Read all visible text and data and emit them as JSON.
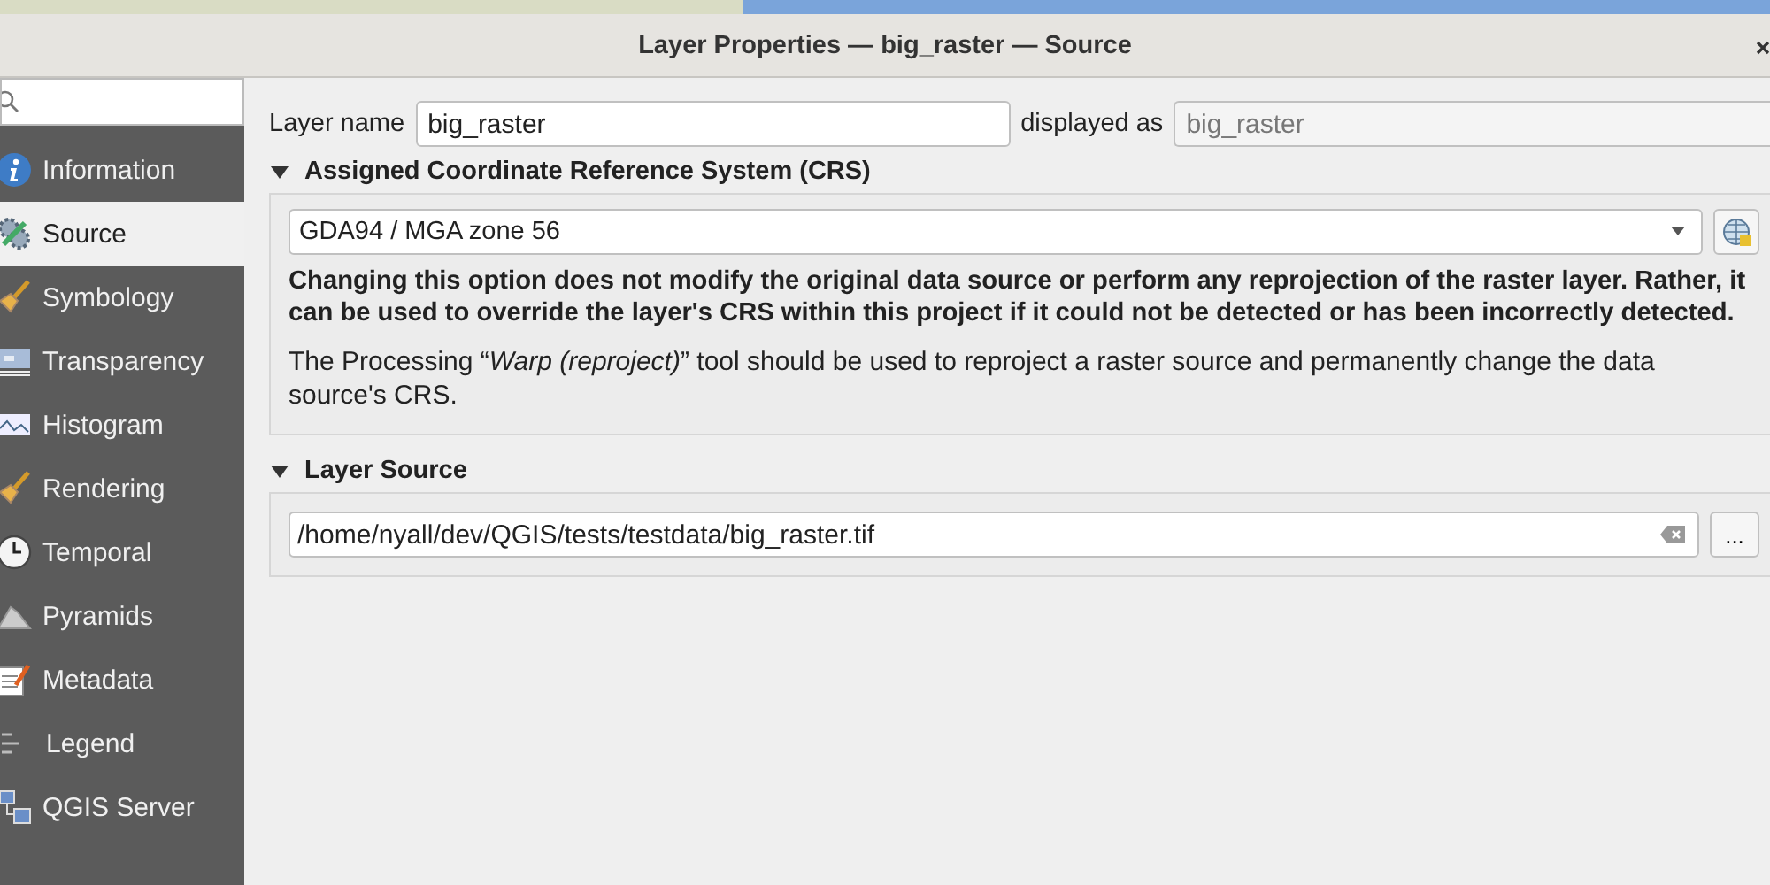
{
  "window": {
    "title": "Layer Properties — big_raster — Source"
  },
  "sidebar": {
    "items": [
      {
        "label": "Information",
        "selected": false
      },
      {
        "label": "Source",
        "selected": true
      },
      {
        "label": "Symbology",
        "selected": false
      },
      {
        "label": "Transparency",
        "selected": false
      },
      {
        "label": "Histogram",
        "selected": false
      },
      {
        "label": "Rendering",
        "selected": false
      },
      {
        "label": "Temporal",
        "selected": false
      },
      {
        "label": "Pyramids",
        "selected": false
      },
      {
        "label": "Metadata",
        "selected": false
      },
      {
        "label": "Legend",
        "selected": false
      },
      {
        "label": "QGIS Server",
        "selected": false
      }
    ]
  },
  "layer_name": {
    "label": "Layer name",
    "value": "big_raster",
    "displayed_as_label": "displayed as",
    "displayed_as_value": "big_raster"
  },
  "crs_section": {
    "title": "Assigned Coordinate Reference System (CRS)",
    "expanded": true,
    "crs_value": "GDA94 / MGA zone 56",
    "warning": "Changing this option does not modify the original data source or perform any reprojection of the raster layer. Rather, it can be used to override the layer's CRS within this project if it could not be detected or has been incorrectly detected.",
    "note": "The Processing “*Warp (reproject)*” tool should be used to reproject a raster source and permanently change the data source's CRS."
  },
  "source_section": {
    "title": "Layer Source",
    "expanded": true,
    "path": "/home/nyall/dev/QGIS/tests/testdata/big_raster.tif",
    "browse_button": "..."
  }
}
